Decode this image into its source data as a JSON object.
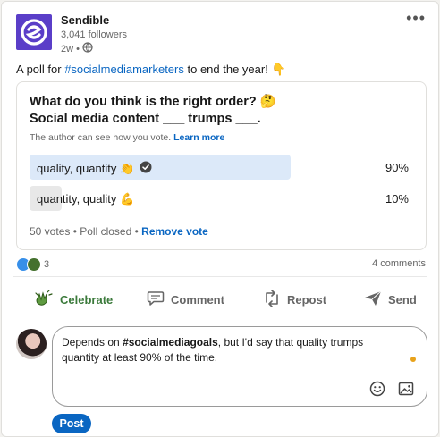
{
  "author": {
    "name": "Sendible",
    "followers": "3,041 followers",
    "time": "2w •"
  },
  "post": {
    "text_before": "A poll for ",
    "hashtag": "#socialmediamarketers",
    "text_after": " to end the year! 👇"
  },
  "poll": {
    "question": "What do you think is the right order? 🤔\nSocial media content ___ trumps ___.",
    "note": "The author can see how you vote.",
    "learn_more": "Learn more",
    "options": [
      {
        "label": "quality, quantity 👏",
        "percent_text": "90%",
        "percent": 90,
        "selected": true
      },
      {
        "label": "quantity, quality 💪",
        "percent_text": "10%",
        "percent": 10,
        "selected": false
      }
    ],
    "votes": "50 votes",
    "status": " • Poll closed • ",
    "remove_vote": "Remove vote"
  },
  "social": {
    "reaction_count": "3",
    "comments": "4 comments"
  },
  "actions": {
    "celebrate": "Celebrate",
    "comment": "Comment",
    "repost": "Repost",
    "send": "Send"
  },
  "composer": {
    "text_before": "Depends on ",
    "hashtag": "#socialmediagoals",
    "text_after": ", but I'd say that quality trumps quantity at least 90% of the time.",
    "post_label": "Post"
  },
  "colors": {
    "accent": "#0a66c2",
    "brand": "#5a3ec8",
    "selected_option": "#dce9f9",
    "unselected_option": "#e8e8e8"
  }
}
